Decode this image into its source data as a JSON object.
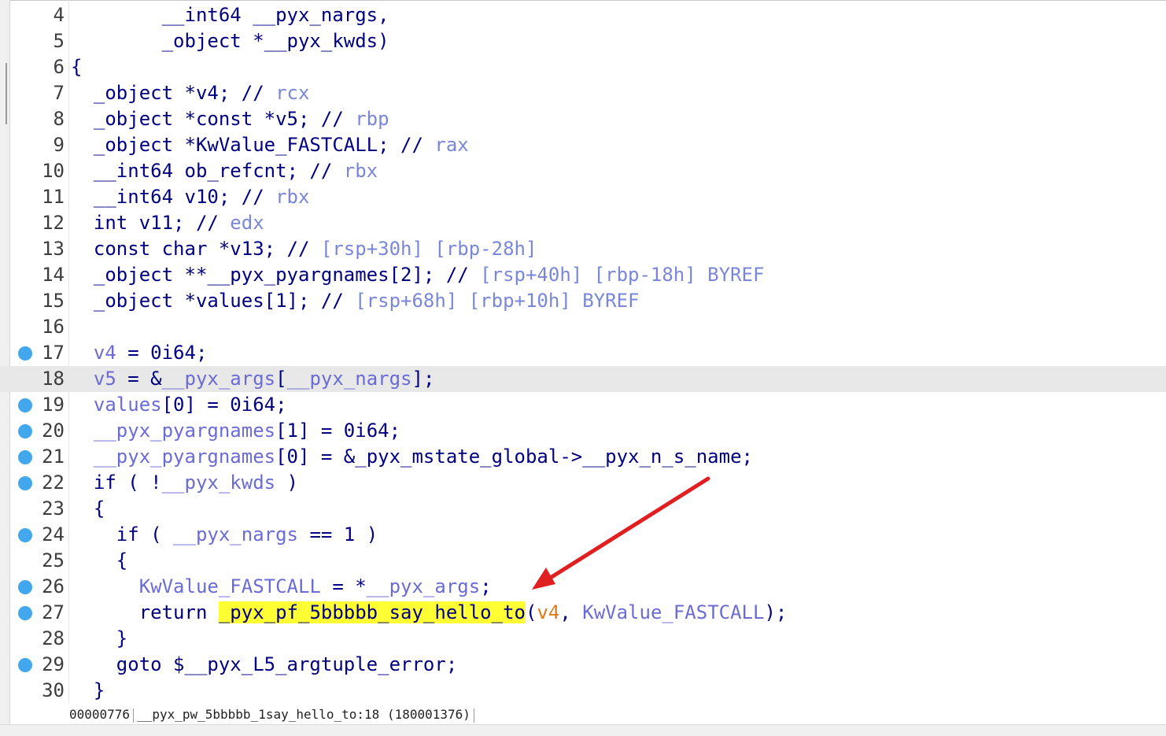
{
  "editor": {
    "lines": [
      {
        "n": "4",
        "bp": false,
        "hl": false,
        "tokens": [
          {
            "t": "        __int64 __pyx_nargs,",
            "c": "k"
          }
        ]
      },
      {
        "n": "5",
        "bp": false,
        "hl": false,
        "tokens": [
          {
            "t": "        _object *__pyx_kwds)",
            "c": "k"
          }
        ]
      },
      {
        "n": "6",
        "bp": false,
        "hl": false,
        "tokens": [
          {
            "t": "{",
            "c": "k"
          }
        ]
      },
      {
        "n": "7",
        "bp": false,
        "hl": false,
        "tokens": [
          {
            "t": "  _object *v4; // ",
            "c": "k"
          },
          {
            "t": "rcx",
            "c": "c"
          }
        ]
      },
      {
        "n": "8",
        "bp": false,
        "hl": false,
        "tokens": [
          {
            "t": "  _object *const *v5; // ",
            "c": "k"
          },
          {
            "t": "rbp",
            "c": "c"
          }
        ]
      },
      {
        "n": "9",
        "bp": false,
        "hl": false,
        "tokens": [
          {
            "t": "  _object *KwValue_FASTCALL; // ",
            "c": "k"
          },
          {
            "t": "rax",
            "c": "c"
          }
        ]
      },
      {
        "n": "10",
        "bp": false,
        "hl": false,
        "tokens": [
          {
            "t": "  __int64 ob_refcnt; // ",
            "c": "k"
          },
          {
            "t": "rbx",
            "c": "c"
          }
        ]
      },
      {
        "n": "11",
        "bp": false,
        "hl": false,
        "tokens": [
          {
            "t": "  __int64 v10; // ",
            "c": "k"
          },
          {
            "t": "rbx",
            "c": "c"
          }
        ]
      },
      {
        "n": "12",
        "bp": false,
        "hl": false,
        "tokens": [
          {
            "t": "  int v11; // ",
            "c": "k"
          },
          {
            "t": "edx",
            "c": "c"
          }
        ]
      },
      {
        "n": "13",
        "bp": false,
        "hl": false,
        "tokens": [
          {
            "t": "  const char *v13; // ",
            "c": "k"
          },
          {
            "t": "[rsp+30h] [rbp-28h]",
            "c": "c"
          }
        ]
      },
      {
        "n": "14",
        "bp": false,
        "hl": false,
        "tokens": [
          {
            "t": "  _object **__pyx_pyargnames[2]; // ",
            "c": "k"
          },
          {
            "t": "[rsp+40h] [rbp-18h] BYREF",
            "c": "c"
          }
        ]
      },
      {
        "n": "15",
        "bp": false,
        "hl": false,
        "tokens": [
          {
            "t": "  _object *values[1]; // ",
            "c": "k"
          },
          {
            "t": "[rsp+68h] [rbp+10h] BYREF",
            "c": "c"
          }
        ]
      },
      {
        "n": "16",
        "bp": false,
        "hl": false,
        "tokens": [
          {
            "t": "",
            "c": "k"
          }
        ]
      },
      {
        "n": "17",
        "bp": true,
        "hl": false,
        "tokens": [
          {
            "t": "  ",
            "c": "k"
          },
          {
            "t": "v4",
            "c": "v"
          },
          {
            "t": " = 0i64;",
            "c": "k"
          }
        ]
      },
      {
        "n": "18",
        "bp": true,
        "hl": true,
        "tokens": [
          {
            "t": "  ",
            "c": "k"
          },
          {
            "t": "v5",
            "c": "v"
          },
          {
            "t": " = &",
            "c": "k"
          },
          {
            "t": "__pyx_args",
            "c": "v"
          },
          {
            "t": "[",
            "c": "k"
          },
          {
            "t": "__pyx_nargs",
            "c": "v"
          },
          {
            "t": "];",
            "c": "k"
          }
        ]
      },
      {
        "n": "19",
        "bp": true,
        "hl": false,
        "tokens": [
          {
            "t": "  ",
            "c": "k"
          },
          {
            "t": "values",
            "c": "v"
          },
          {
            "t": "[0] = 0i64;",
            "c": "k"
          }
        ]
      },
      {
        "n": "20",
        "bp": true,
        "hl": false,
        "tokens": [
          {
            "t": "  ",
            "c": "k"
          },
          {
            "t": "__pyx_pyargnames",
            "c": "v"
          },
          {
            "t": "[1] = 0i64;",
            "c": "k"
          }
        ]
      },
      {
        "n": "21",
        "bp": true,
        "hl": false,
        "tokens": [
          {
            "t": "  ",
            "c": "k"
          },
          {
            "t": "__pyx_pyargnames",
            "c": "v"
          },
          {
            "t": "[0] = &_pyx_mstate_global->__pyx_n_s_name;",
            "c": "k"
          }
        ]
      },
      {
        "n": "22",
        "bp": true,
        "hl": false,
        "tokens": [
          {
            "t": "  if ( !",
            "c": "k"
          },
          {
            "t": "__pyx_kwds",
            "c": "v"
          },
          {
            "t": " )",
            "c": "k"
          }
        ]
      },
      {
        "n": "23",
        "bp": false,
        "hl": false,
        "tokens": [
          {
            "t": "  {",
            "c": "k"
          }
        ]
      },
      {
        "n": "24",
        "bp": true,
        "hl": false,
        "tokens": [
          {
            "t": "    if ( ",
            "c": "k"
          },
          {
            "t": "__pyx_nargs",
            "c": "v"
          },
          {
            "t": " == 1 )",
            "c": "k"
          }
        ]
      },
      {
        "n": "25",
        "bp": false,
        "hl": false,
        "tokens": [
          {
            "t": "    {",
            "c": "k"
          }
        ]
      },
      {
        "n": "26",
        "bp": true,
        "hl": false,
        "tokens": [
          {
            "t": "      ",
            "c": "k"
          },
          {
            "t": "KwValue_FASTCALL",
            "c": "v"
          },
          {
            "t": " = *",
            "c": "k"
          },
          {
            "t": "__pyx_args",
            "c": "v"
          },
          {
            "t": ";",
            "c": "k"
          }
        ]
      },
      {
        "n": "27",
        "bp": true,
        "hl": false,
        "tokens": [
          {
            "t": "      return ",
            "c": "k"
          },
          {
            "t": "_pyx_pf_5bbbbb_say_hello_to",
            "c": "h"
          },
          {
            "t": "(",
            "c": "k"
          },
          {
            "t": "v4",
            "c": "o"
          },
          {
            "t": ", ",
            "c": "k"
          },
          {
            "t": "KwValue_FASTCALL",
            "c": "v"
          },
          {
            "t": ");",
            "c": "k"
          }
        ]
      },
      {
        "n": "28",
        "bp": false,
        "hl": false,
        "tokens": [
          {
            "t": "    }",
            "c": "k"
          }
        ]
      },
      {
        "n": "29",
        "bp": true,
        "hl": false,
        "tokens": [
          {
            "t": "    goto $__pyx_L5_argtuple_error;",
            "c": "k"
          }
        ]
      },
      {
        "n": "30",
        "bp": false,
        "hl": false,
        "tokens": [
          {
            "t": "  }",
            "c": "k"
          }
        ]
      }
    ]
  },
  "status": {
    "offset": "00000776",
    "location": "__pyx_pw_5bbbbb_1say_hello_to:18 (180001376)"
  },
  "colors": {
    "keyword": "#000080",
    "variable": "#6b6bd6",
    "comment": "#7a87d8",
    "highlight": "#ffff33",
    "argument": "#e07a1a",
    "breakpoint": "#42a7ed",
    "arrow": "#e02020"
  }
}
